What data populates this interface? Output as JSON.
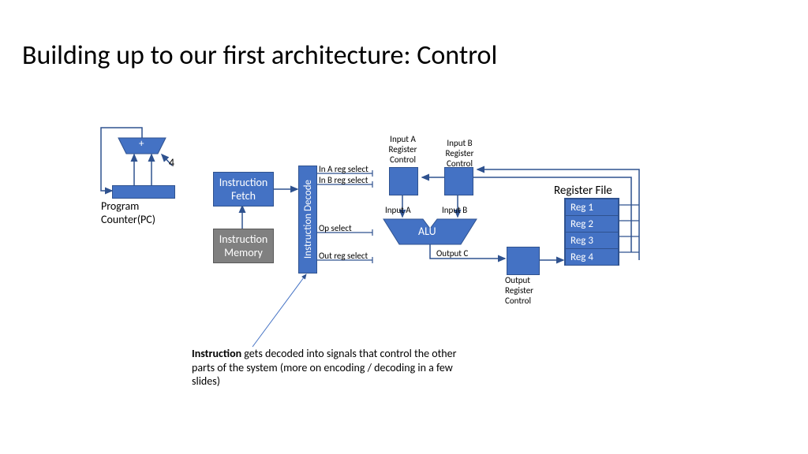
{
  "title": "Building up to our first architecture: Control",
  "pc": {
    "label": "Program\nCounter(PC)",
    "incr": "4",
    "plus": "+"
  },
  "ifetch": "Instruction\nFetch",
  "imem": "Instruction\nMemory",
  "idecode": "Instruction Decode",
  "signals": {
    "inA": "In A reg select",
    "inB": "In B reg select",
    "op": "Op select",
    "out": "Out reg select"
  },
  "ctrlBoxes": {
    "inputA": "Input A\nRegister\nControl",
    "inputB": "Input B\nRegister\nControl",
    "output": "Output\nRegister\nControl"
  },
  "alu": {
    "label": "ALU",
    "inA": "Input A",
    "inB": "Input B",
    "outC": "Output C"
  },
  "regfile": {
    "title": "Register File",
    "regs": [
      "Reg 1",
      "Reg 2",
      "Reg 3",
      "Reg 4"
    ]
  },
  "annotation": {
    "bold": "Instruction",
    "rest": " gets decoded into signals that control the other parts of the system (more on encoding / decoding in a  few slides)"
  }
}
